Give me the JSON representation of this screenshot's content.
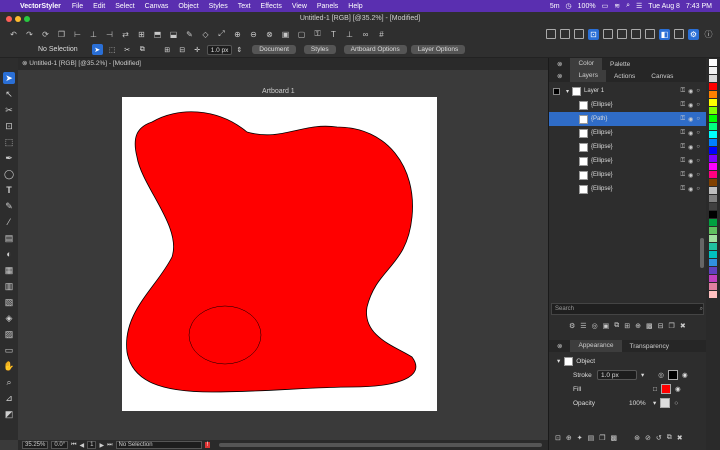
{
  "menubar": {
    "app": "VectorStyler",
    "items": [
      "File",
      "Edit",
      "Select",
      "Canvas",
      "Object",
      "Styles",
      "Text",
      "Effects",
      "View",
      "Panels",
      "Help"
    ],
    "status": {
      "time5m": "5m",
      "battery": "100%",
      "date": "Tue Aug 8",
      "time": "7:43 PM"
    }
  },
  "window": {
    "title": "Untitled-1 [RGB] [@35.2%] - [Modified]"
  },
  "toolbar2": {
    "selection": "No Selection",
    "stroke_width": "1.0 px",
    "buttons": [
      "Document",
      "Styles",
      "Artboard Options",
      "Layer Options"
    ]
  },
  "document": {
    "tab": "Untitled-1 [RGB] [@35.2%] - [Modified]",
    "artboard": "Artboard 1"
  },
  "statusbar": {
    "zoom": "35.25%",
    "angle": "0.0°",
    "page": "1",
    "selection": "No Selection"
  },
  "colors": {
    "fill": "#ff0000",
    "stroke": "#000000",
    "accent": "#2f6cc7",
    "menubar": "#5a2fb0"
  },
  "panels": {
    "top_tabs": [
      "Color",
      "Palette"
    ],
    "layer_tabs": [
      "Layers",
      "Actions",
      "Canvas"
    ],
    "layers": [
      {
        "name": "Layer 1",
        "level": 0
      },
      {
        "name": "{Ellipse}",
        "level": 1
      },
      {
        "name": "{Path}",
        "level": 1,
        "selected": true
      },
      {
        "name": "{Ellipse}",
        "level": 1
      },
      {
        "name": "{Ellipse}",
        "level": 1
      },
      {
        "name": "{Ellipse}",
        "level": 1
      },
      {
        "name": "{Ellipse}",
        "level": 1
      },
      {
        "name": "{Ellipse}",
        "level": 1
      }
    ],
    "search_placeholder": "Search",
    "appearance_tabs": [
      "Appearance",
      "Transparency"
    ],
    "appearance": {
      "object": "Object",
      "stroke_label": "Stroke",
      "stroke_value": "1.0 px",
      "fill_label": "Fill",
      "opacity_label": "Opacity",
      "opacity_value": "100%"
    }
  },
  "swatches": [
    "#ffffff",
    "#f2f2f2",
    "#d9d9d9",
    "#ff0000",
    "#ff8000",
    "#ffff00",
    "#80ff00",
    "#00ff00",
    "#00ff80",
    "#00ffff",
    "#0080ff",
    "#0000ff",
    "#8000ff",
    "#ff00ff",
    "#ff0080",
    "#804000",
    "#c0c0c0",
    "#808080",
    "#404040",
    "#000000",
    "#00a040",
    "#60c060",
    "#a0e0a0",
    "#20c0a0",
    "#00c0c0",
    "#3090e0",
    "#6040c0",
    "#c040c0",
    "#e080a0",
    "#ffc0c0"
  ]
}
